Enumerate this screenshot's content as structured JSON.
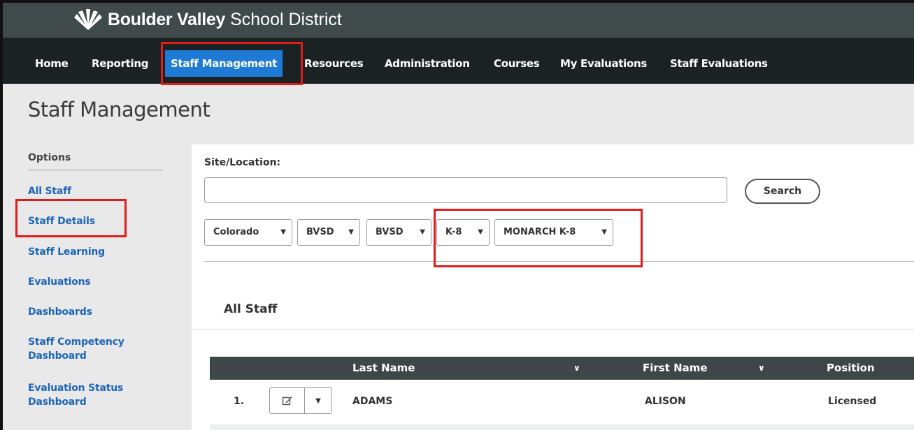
{
  "brand": {
    "title_bold": "Boulder Valley",
    "title_rest": "School District"
  },
  "nav": {
    "items": [
      "Home",
      "Reporting",
      "Staff Management",
      "Resources",
      "Administration",
      "Courses",
      "My Evaluations",
      "Staff Evaluations"
    ],
    "active": "Staff Management"
  },
  "page": {
    "title": "Staff Management"
  },
  "sidebar": {
    "options_label": "Options",
    "links": [
      "All Staff",
      "Staff Details",
      "Staff Learning",
      "Evaluations",
      "Dashboards",
      "Staff Competency Dashboard",
      "Evaluation Status Dashboard"
    ]
  },
  "search": {
    "site_label": "Site/Location:",
    "input_value": "",
    "button_label": "Search"
  },
  "filters": {
    "dropdowns": [
      "Colorado",
      "BVSD",
      "BVSD",
      "K-8",
      "MONARCH K-8"
    ]
  },
  "section": {
    "title": "All Staff"
  },
  "table": {
    "columns": [
      "Last Name",
      "First Name",
      "Position"
    ],
    "rows": [
      {
        "index": "1.",
        "last_name": "ADAMS",
        "first_name": "ALISON",
        "position": "Licensed"
      }
    ]
  },
  "colors": {
    "nav_bg": "#1a2224",
    "topbar_bg": "#404a4b",
    "active_tab": "#1f7ad6",
    "link": "#1f66b8",
    "highlight": "#e21b1b"
  }
}
